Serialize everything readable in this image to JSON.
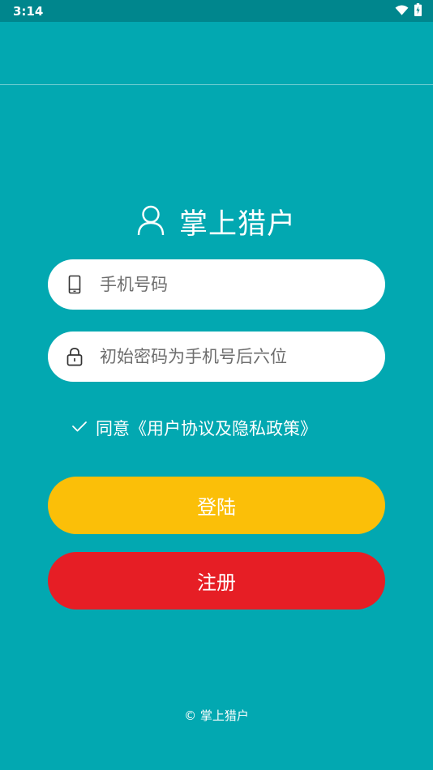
{
  "status_bar": {
    "time": "3:14",
    "icons": [
      "wifi-icon",
      "battery-charging-icon"
    ]
  },
  "brand": {
    "icon": "user-icon",
    "title": "掌上猎户"
  },
  "phone_field": {
    "icon": "phone-icon",
    "value": "",
    "placeholder": "手机号码"
  },
  "password_field": {
    "icon": "lock-icon",
    "value": "",
    "placeholder": "初始密码为手机号后六位"
  },
  "agreement": {
    "checked": true,
    "icon": "check-icon",
    "label": "同意《用户协议及隐私政策》"
  },
  "buttons": {
    "login_label": "登陆",
    "register_label": "注册"
  },
  "footer": {
    "text": "© 掌上猎户"
  },
  "colors": {
    "background": "#02a8b1",
    "status_bar": "#00868d",
    "login_button": "#fbbf08",
    "register_button": "#e61e25"
  }
}
